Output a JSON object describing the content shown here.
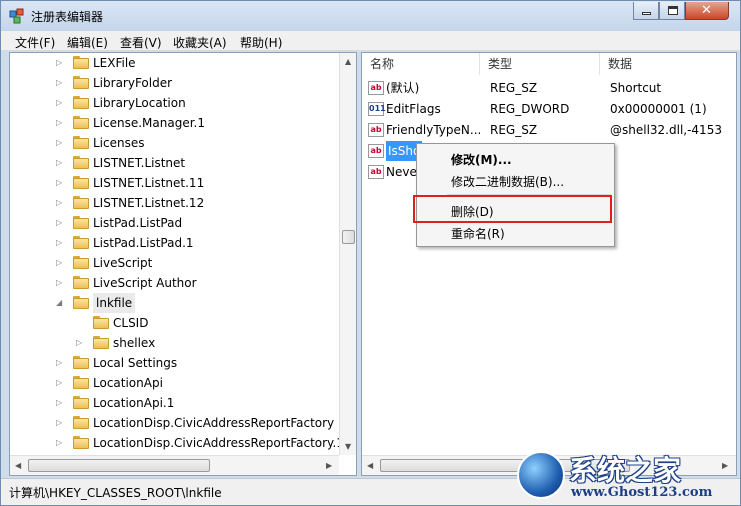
{
  "window": {
    "title": "注册表编辑器"
  },
  "menu": [
    "文件(F)",
    "编辑(E)",
    "查看(V)",
    "收藏夹(A)",
    "帮助(H)"
  ],
  "tree": [
    {
      "label": "LEXFile",
      "level": 1,
      "expander": "collapsed"
    },
    {
      "label": "LibraryFolder",
      "level": 1,
      "expander": "collapsed"
    },
    {
      "label": "LibraryLocation",
      "level": 1,
      "expander": "collapsed"
    },
    {
      "label": "License.Manager.1",
      "level": 1,
      "expander": "collapsed"
    },
    {
      "label": "Licenses",
      "level": 1,
      "expander": "collapsed"
    },
    {
      "label": "LISTNET.Listnet",
      "level": 1,
      "expander": "collapsed"
    },
    {
      "label": "LISTNET.Listnet.11",
      "level": 1,
      "expander": "collapsed"
    },
    {
      "label": "LISTNET.Listnet.12",
      "level": 1,
      "expander": "collapsed"
    },
    {
      "label": "ListPad.ListPad",
      "level": 1,
      "expander": "collapsed"
    },
    {
      "label": "ListPad.ListPad.1",
      "level": 1,
      "expander": "collapsed"
    },
    {
      "label": "LiveScript",
      "level": 1,
      "expander": "collapsed"
    },
    {
      "label": "LiveScript Author",
      "level": 1,
      "expander": "collapsed"
    },
    {
      "label": "lnkfile",
      "level": 1,
      "expander": "expanded",
      "selected": true
    },
    {
      "label": "CLSID",
      "level": 2,
      "expander": "none"
    },
    {
      "label": "shellex",
      "level": 2,
      "expander": "collapsed"
    },
    {
      "label": "Local Settings",
      "level": 1,
      "expander": "collapsed"
    },
    {
      "label": "LocationApi",
      "level": 1,
      "expander": "collapsed"
    },
    {
      "label": "LocationApi.1",
      "level": 1,
      "expander": "collapsed"
    },
    {
      "label": "LocationDisp.CivicAddressReportFactory",
      "level": 1,
      "expander": "collapsed"
    },
    {
      "label": "LocationDisp.CivicAddressReportFactory.1",
      "level": 1,
      "expander": "collapsed"
    }
  ],
  "values_header": {
    "name": "名称",
    "type": "类型",
    "data": "数据"
  },
  "values": [
    {
      "icon": "string-value-icon",
      "badge": "ab",
      "name": "(默认)",
      "type": "REG_SZ",
      "data": "Shortcut"
    },
    {
      "icon": "binary-value-icon",
      "badge": "011",
      "name": "EditFlags",
      "type": "REG_DWORD",
      "data": "0x00000001 (1)"
    },
    {
      "icon": "string-value-icon",
      "badge": "ab",
      "name": "FriendlyTypeN...",
      "type": "REG_SZ",
      "data": "@shell32.dll,-4153"
    },
    {
      "icon": "string-value-icon",
      "badge": "ab",
      "name": "IsSho",
      "type": "",
      "data": "",
      "selected": true
    },
    {
      "icon": "string-value-icon",
      "badge": "ab",
      "name": "Neve",
      "type": "",
      "data": ""
    }
  ],
  "context_menu": {
    "modify": "修改(M)...",
    "modify_binary": "修改二进制数据(B)...",
    "delete": "删除(D)",
    "rename": "重命名(R)"
  },
  "status_path": "计算机\\HKEY_CLASSES_ROOT\\lnkfile",
  "watermark": {
    "title": "系统之家",
    "url": "www.Ghost123.com"
  }
}
